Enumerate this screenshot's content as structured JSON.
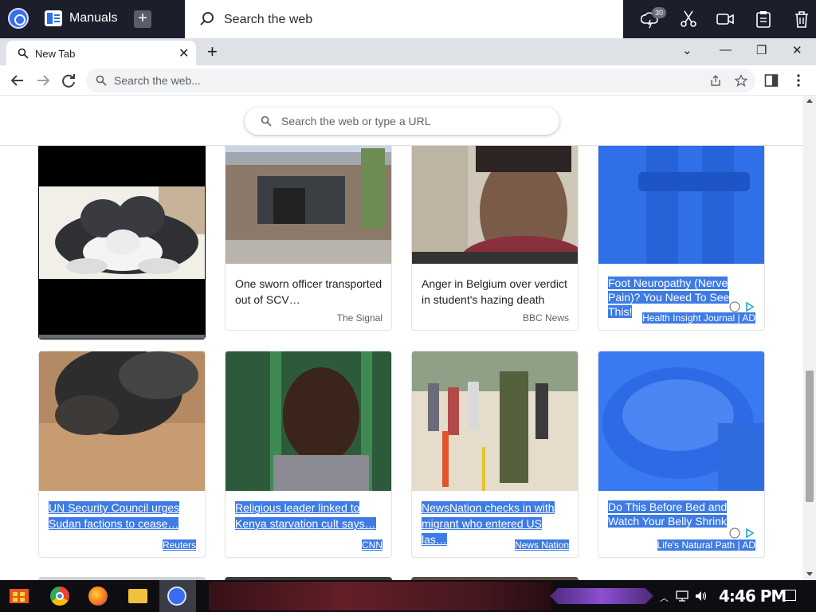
{
  "topbar": {
    "app_name": "Manuals",
    "search_placeholder": "Search the web",
    "badge_count": "30",
    "icons": [
      "app-logo-icon",
      "manuals-icon",
      "add-icon",
      "search-icon",
      "weather-icon",
      "scissors-icon",
      "video-icon",
      "clipboard-icon",
      "trash-icon"
    ]
  },
  "browser": {
    "tab_title": "New Tab",
    "omnibox_placeholder": "Search the web..."
  },
  "page": {
    "search_placeholder": "Search the web or type a URL",
    "cards_row1": [
      {
        "title": "",
        "source": "",
        "image": "husky-puppy"
      },
      {
        "title": "One sworn officer transported out of SCV…",
        "source": "The Signal",
        "image": "building"
      },
      {
        "title": "Anger in Belgium over verdict in student's hazing death",
        "source": "BBC News",
        "image": "mural"
      },
      {
        "title": "Foot Neuropathy (Nerve Pain)? You Need To See This!",
        "source": "Health Insight Journal | AD",
        "image": "legs-ad"
      }
    ],
    "cards_row2": [
      {
        "title": "UN Security Council urges Sudan factions to cease…",
        "source": "Reuters",
        "image": "smoke-city"
      },
      {
        "title": "Religious leader linked to Kenya starvation cult says…",
        "source": "CNN",
        "image": "man-portrait"
      },
      {
        "title": "NewsNation checks in with migrant who entered US las…",
        "source": "News Nation",
        "image": "border-crowd"
      },
      {
        "title": "Do This Before Bed and Watch Your Belly Shrink",
        "source": "Life's Natural Path | AD",
        "image": "bowl-ad"
      }
    ]
  },
  "taskbar": {
    "clock": "4:46 PM"
  },
  "colors": {
    "selection": "#3e7be4",
    "topbar_bg": "#1c1f2b",
    "tabstrip_bg": "#dee1e6"
  }
}
